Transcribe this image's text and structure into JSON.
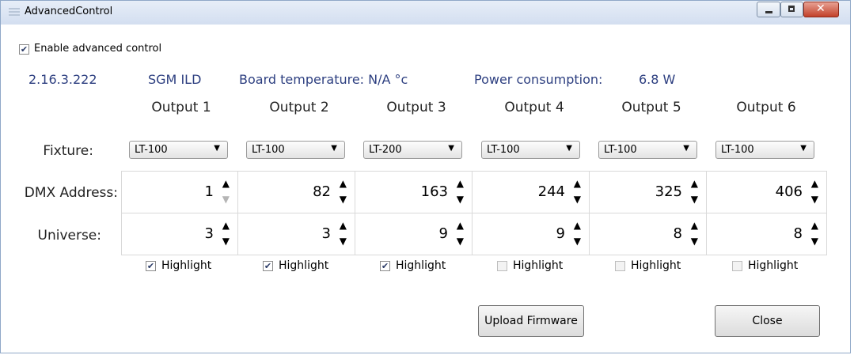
{
  "window": {
    "title": "AdvancedControl"
  },
  "enable": {
    "label": "Enable advanced control",
    "checked": true
  },
  "info": {
    "version": "2.16.3.222",
    "device": "SGM ILD",
    "board_temp": "Board temperature: N/A °c",
    "power_label": "Power consumption:",
    "power_value": "6.8 W"
  },
  "outputs": [
    {
      "name": "Output 1",
      "fixture": "LT-100",
      "dmx": "1",
      "universe": "3",
      "highlight": true
    },
    {
      "name": "Output 2",
      "fixture": "LT-100",
      "dmx": "82",
      "universe": "3",
      "highlight": true
    },
    {
      "name": "Output 3",
      "fixture": "LT-200",
      "dmx": "163",
      "universe": "9",
      "highlight": true
    },
    {
      "name": "Output 4",
      "fixture": "LT-100",
      "dmx": "244",
      "universe": "9",
      "highlight": false
    },
    {
      "name": "Output 5",
      "fixture": "LT-100",
      "dmx": "325",
      "universe": "8",
      "highlight": false
    },
    {
      "name": "Output 6",
      "fixture": "LT-100",
      "dmx": "406",
      "universe": "8",
      "highlight": false
    }
  ],
  "labels": {
    "fixture": "Fixture:",
    "dmx": "DMX Address:",
    "universe": "Universe:",
    "highlight": "Highlight"
  },
  "buttons": {
    "upload": "Upload Firmware",
    "close": "Close"
  },
  "colors": {
    "info_text": "#2d3f80",
    "close_button": "#c2412a"
  }
}
